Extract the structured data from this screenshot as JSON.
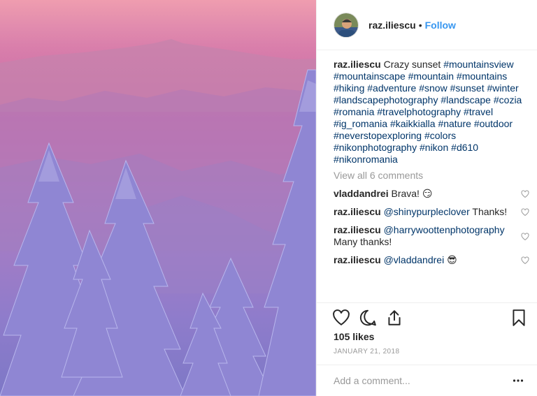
{
  "post": {
    "image_icon": "landscape-photo",
    "author": "raz.iliescu",
    "separator": "•",
    "follow_label": "Follow",
    "caption_text": "Crazy sunset",
    "hashtags": [
      "#mountainsview",
      "#mountainscape",
      "#mountain",
      "#mountains",
      "#hiking",
      "#adventure",
      "#snow",
      "#sunset",
      "#winter",
      "#landscapephotography",
      "#landscape",
      "#cozia",
      "#romania",
      "#travelphotography",
      "#travel",
      "#ig_romania",
      "#kaikkialla",
      "#nature",
      "#outdoor",
      "#neverstopexploring",
      "#colors",
      "#nikonphotography",
      "#nikon",
      "#d610",
      "#nikonromania"
    ],
    "view_all": "View all 6 comments",
    "comments": [
      {
        "user": "vladdandrei",
        "mention": "",
        "text": "Brava! 😏"
      },
      {
        "user": "raz.iliescu",
        "mention": "@shinypurpleclover",
        "text": "Thanks!"
      },
      {
        "user": "raz.iliescu",
        "mention": "@harrywoottenphotography",
        "text": "Many thanks!"
      },
      {
        "user": "raz.iliescu",
        "mention": "@vladdandrei",
        "text": "😎"
      }
    ],
    "likes": "105 likes",
    "date": "JANUARY 21, 2018",
    "comment_placeholder": "Add a comment...",
    "link_color": "#003569",
    "follow_color": "#3897f0",
    "icons": {
      "like": "heart-icon",
      "comment": "comment-icon",
      "share": "share-icon",
      "save": "bookmark-icon",
      "more": "more-options-icon"
    }
  }
}
